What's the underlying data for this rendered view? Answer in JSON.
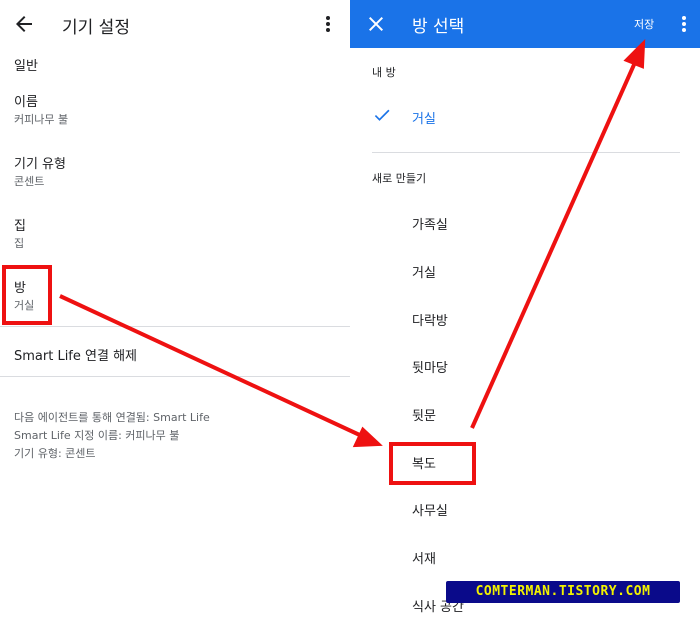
{
  "left_panel": {
    "title": "기기 설정",
    "section_general": "일반",
    "name": {
      "label": "이름",
      "value": "커피나무 불"
    },
    "device_type": {
      "label": "기기 유형",
      "value": "콘센트"
    },
    "home": {
      "label": "집",
      "value": "집"
    },
    "room": {
      "label": "방",
      "value": "거실"
    },
    "unlink": "Smart Life 연결 해제",
    "info_lines": [
      "다음 에이전트를 통해 연결됨: Smart Life",
      "Smart Life 지정 이름: 커피나무 불",
      "기기 유형: 콘센트"
    ]
  },
  "right_panel": {
    "title": "방 선택",
    "save": "저장",
    "my_rooms_label": "내 방",
    "selected_room": "거실",
    "create_new_label": "새로 만들기",
    "rooms": [
      "가족실",
      "거실",
      "다락방",
      "뒷마당",
      "뒷문",
      "복도",
      "사무실",
      "서재",
      "식사 공간"
    ]
  },
  "watermark": "COMTERMAN.TISTORY.COM",
  "colors": {
    "app_bar": "#1a73e8",
    "annotation": "#ee1111",
    "watermark_bg": "#0a0a8a",
    "watermark_text": "#f2f200"
  },
  "icons": {
    "back": "arrow-left-icon",
    "more": "more-vert-icon",
    "close": "close-icon",
    "check": "check-icon"
  }
}
